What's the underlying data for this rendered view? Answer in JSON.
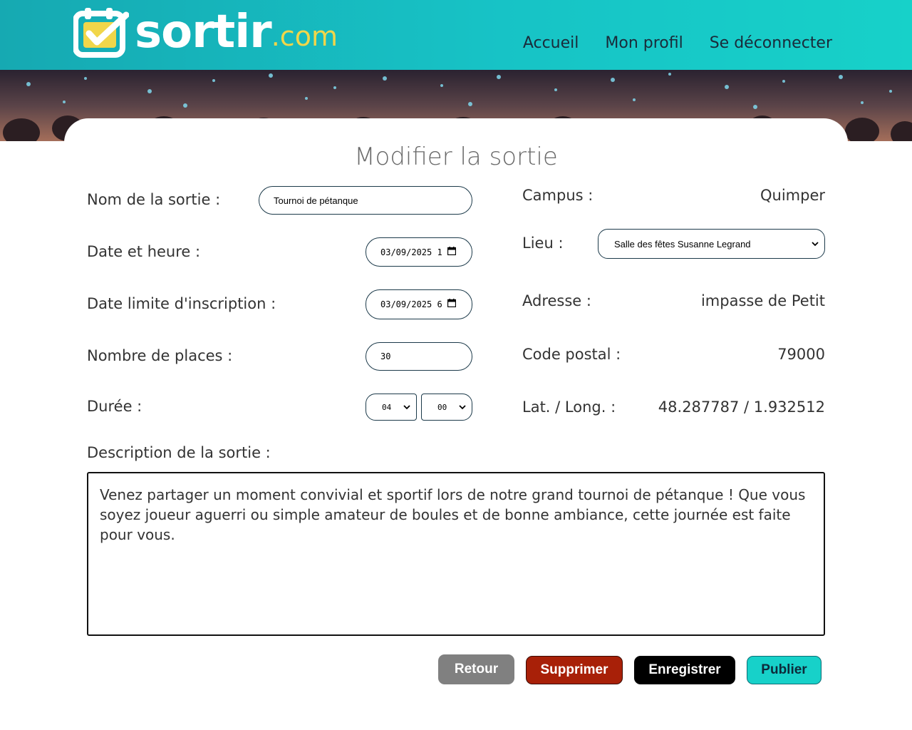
{
  "header": {
    "logo_text": "sortir",
    "logo_suffix": ".com",
    "nav": [
      "Accueil",
      "Mon profil",
      "Se déconnecter"
    ]
  },
  "page_title": "Modifier la sortie",
  "form": {
    "nom_label": "Nom de la sortie :",
    "nom_value": "Tournoi de pétanque",
    "date_label": "Date et heure :",
    "date_value": "03/09/2025  1",
    "limite_label": "Date limite d'inscription :",
    "limite_value": "03/09/2025  6",
    "places_label": "Nombre de places :",
    "places_value": "30",
    "duree_label": "Durée :",
    "duree_hours": "04",
    "duree_minutes": "00",
    "description_label": "Description de la sortie :",
    "description_value": "Venez partager un moment convivial et sportif lors de notre grand tournoi de pétanque ! Que vous soyez joueur aguerri ou simple amateur de boules et de bonne ambiance, cette journée est faite pour vous."
  },
  "info": {
    "campus_label": "Campus :",
    "campus_value": "Quimper",
    "lieu_label": "Lieu :",
    "lieu_value": "Salle des fêtes Susanne Legrand",
    "adresse_label": "Adresse :",
    "adresse_value": "impasse de Petit",
    "cp_label": "Code postal :",
    "cp_value": "79000",
    "latlong_label": "Lat. / Long. :",
    "latlong_value": "48.287787 / 1.932512"
  },
  "buttons": {
    "retour": "Retour",
    "supprimer": "Supprimer",
    "enregistrer": "Enregistrer",
    "publier": "Publier"
  },
  "colors": {
    "header_teal": "#17c3c6",
    "logo_yellow": "#f1d64a",
    "supprimer_red": "#a82008",
    "publier_teal": "#17d1c9"
  }
}
